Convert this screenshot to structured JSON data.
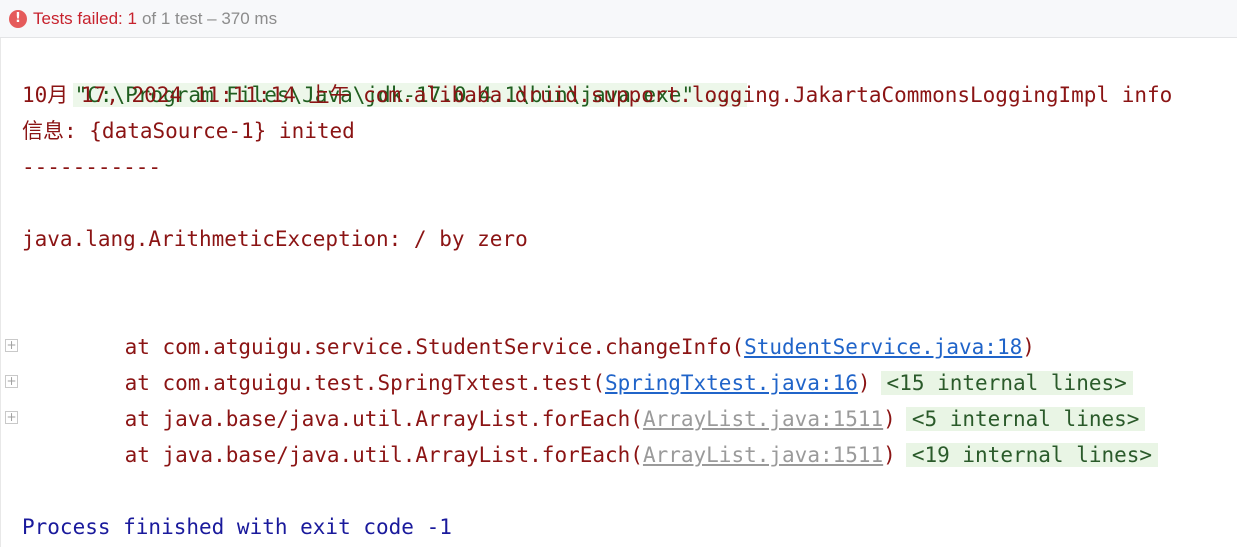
{
  "header": {
    "fail_icon_glyph": "!",
    "status_failed": "Tests failed: 1",
    "status_rest": "of 1 test – 370 ms"
  },
  "console": {
    "command_line": "\"C:\\Program Files\\Java\\jdk-17.0.4.1\\bin\\java.exe\" ...",
    "log_line_1": "10月 17, 2024 11:11:14 上午 com.alibaba.druid.support.logging.JakartaCommonsLoggingImpl info",
    "log_line_2": "信息: {dataSource-1} inited",
    "separator": "-----------",
    "exception": "java.lang.ArithmeticException: / by zero",
    "stack": [
      {
        "prefix": "at com.atguigu.service.StudentService.changeInfo(",
        "link": "StudentService.java:18",
        "suffix": ")",
        "internal": ""
      },
      {
        "prefix": "at com.atguigu.test.SpringTxtest.test(",
        "link": "SpringTxtest.java:16",
        "suffix": ")",
        "internal": "<15 internal lines>"
      },
      {
        "prefix": "at java.base/java.util.ArrayList.forEach(",
        "link": "ArrayList.java:1511",
        "suffix": ")",
        "internal": "<5 internal lines>"
      },
      {
        "prefix": "at java.base/java.util.ArrayList.forEach(",
        "link": "ArrayList.java:1511",
        "suffix": ")",
        "internal": "<19 internal lines>"
      }
    ],
    "expander_glyph": "+",
    "exit_line": "Process finished with exit code -1"
  },
  "colors": {
    "error_text": "#8b1414",
    "link": "#2064c9",
    "fail_icon": "#e55b5b",
    "internal_bg": "#e9f5e5"
  }
}
